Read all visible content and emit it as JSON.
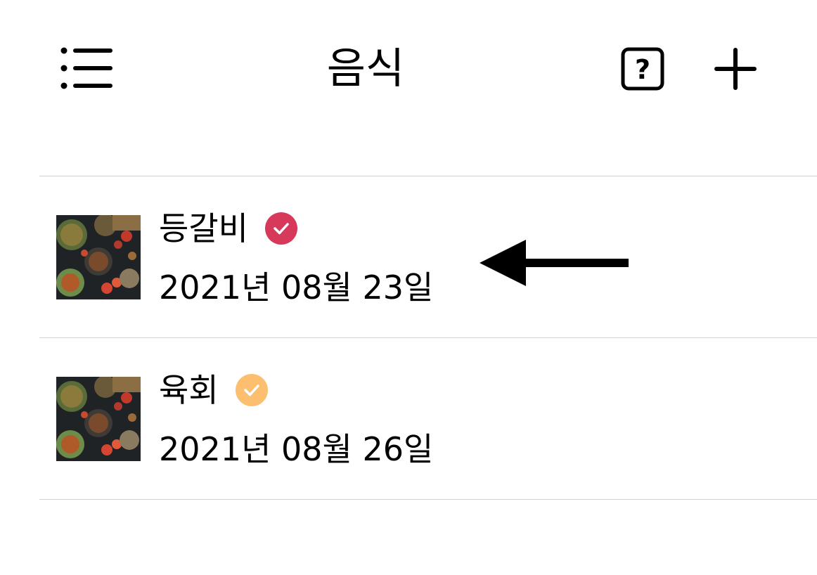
{
  "header": {
    "title": "음식",
    "menu_icon": "list-icon",
    "help_icon": "help-square-icon",
    "add_icon": "plus-icon"
  },
  "items": [
    {
      "name": "등갈비",
      "date": "2021년 08월 23일",
      "status_color": "#d7395a",
      "status_icon": "check-circle-icon",
      "highlighted": true
    },
    {
      "name": "육회",
      "date": "2021년 08월 26일",
      "status_color": "#fbbf6f",
      "status_icon": "check-circle-icon",
      "highlighted": false
    }
  ],
  "colors": {
    "divider": "#d2d2d2",
    "text": "#000000"
  }
}
